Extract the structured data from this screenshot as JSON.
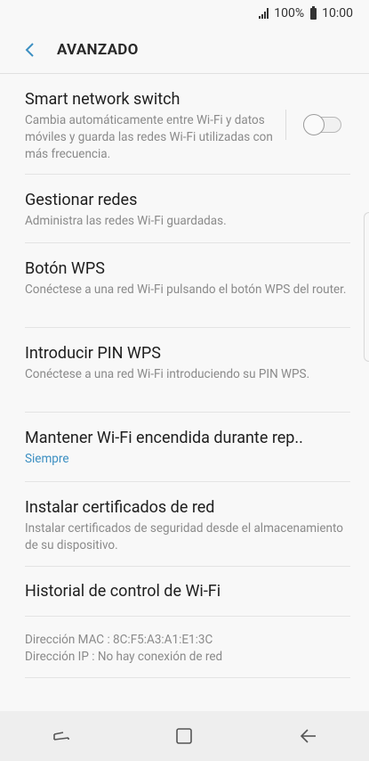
{
  "status_bar": {
    "battery_text": "100%",
    "time": "10:00"
  },
  "header": {
    "title": "AVANZADO",
    "back_icon": "chevron-left-icon"
  },
  "items": [
    {
      "title": "Smart network switch",
      "subtitle": "Cambia automáticamente entre Wi-Fi y datos móviles y guarda las redes Wi-Fi utilizadas con más frecuencia.",
      "toggle_on": false
    },
    {
      "title": "Gestionar redes",
      "subtitle": "Administra las redes Wi-Fi guardadas."
    },
    {
      "title": "Botón WPS",
      "subtitle": "Conéctese a una red Wi-Fi pulsando el botón WPS del router."
    },
    {
      "title": "Introducir PIN WPS",
      "subtitle": "Conéctese a una red Wi-Fi introduciendo su PIN WPS."
    },
    {
      "title": "Mantener Wi-Fi encendida durante rep..",
      "subtitle": "Siempre"
    },
    {
      "title": "Instalar certificados de red",
      "subtitle": "Instalar certificados de seguridad desde el almacenamiento de su dispositivo."
    },
    {
      "title": "Historial de control de Wi-Fi"
    }
  ],
  "info": {
    "mac": "Dirección MAC : 8C:F5:A3:A1:E1:3C",
    "ip": "Dirección IP : No hay conexión de red"
  },
  "nav_bar": {
    "recent_icon": "recent-apps-icon",
    "home_icon": "home-icon",
    "back_icon": "back-arrow-icon"
  },
  "colors": {
    "accent": "#3c8fc2",
    "background": "#f8f8f8"
  }
}
